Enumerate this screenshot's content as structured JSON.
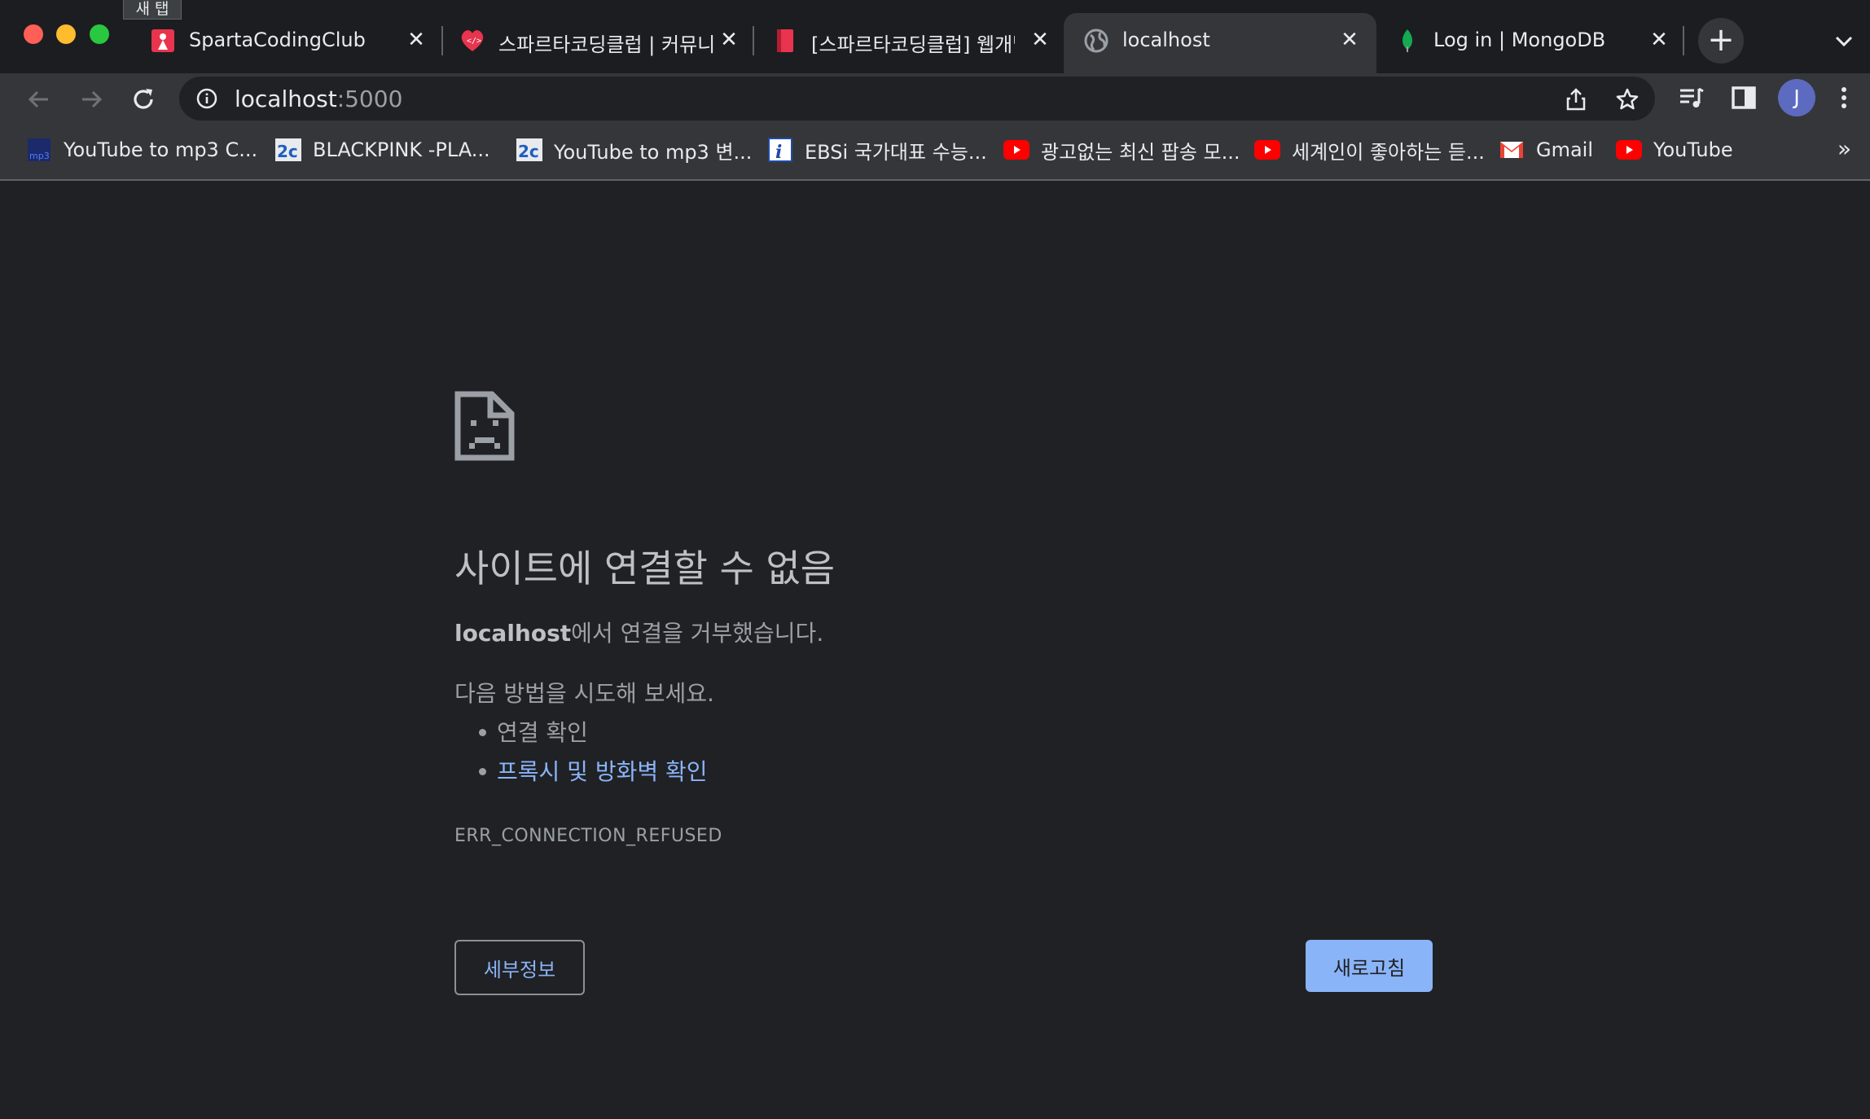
{
  "window": {
    "tooltip": "새 탭"
  },
  "tabs": [
    {
      "title": "SpartaCodingClub",
      "close": "✕"
    },
    {
      "title": "스파르타코딩클럽 | 커뮤니",
      "close": "✕"
    },
    {
      "title": "[스파르타코딩클럽] 웹개발",
      "close": "✕"
    },
    {
      "title": "localhost",
      "close": "✕",
      "active": true
    },
    {
      "title": "Log in | MongoDB",
      "close": "✕"
    }
  ],
  "newtab_label": "+",
  "omnibox": {
    "host": "localhost",
    "port": ":5000"
  },
  "profile": {
    "initial": "J"
  },
  "bookmarks": [
    {
      "label": "YouTube to mp3 C...",
      "icon": "mp3-icon"
    },
    {
      "label": "BLACKPINK -PLA...",
      "icon": "2c-icon"
    },
    {
      "label": "YouTube to mp3 변...",
      "icon": "2c-icon"
    },
    {
      "label": "EBSi 국가대표 수능...",
      "icon": "info-i-icon"
    },
    {
      "label": "광고없는 최신 팝송 모...",
      "icon": "youtube-icon"
    },
    {
      "label": "세계인이 좋아하는 듣...",
      "icon": "youtube-icon"
    },
    {
      "label": "Gmail",
      "icon": "gmail-icon"
    },
    {
      "label": "YouTube",
      "icon": "youtube-icon"
    }
  ],
  "bookmarks_more": "»",
  "error": {
    "title": "사이트에 연결할 수 없음",
    "host": "localhost",
    "desc_suffix": "에서 연결을 거부했습니다.",
    "try_text": "다음 방법을 시도해 보세요.",
    "suggestions": [
      "연결 확인",
      "프록시 및 방화벽 확인"
    ],
    "code": "ERR_CONNECTION_REFUSED",
    "details_button": "세부정보",
    "reload_button": "새로고침"
  },
  "colors": {
    "background": "#202124",
    "toolbar": "#35363a",
    "link": "#8ab4f8",
    "reload_button": "#8ab4f8"
  }
}
